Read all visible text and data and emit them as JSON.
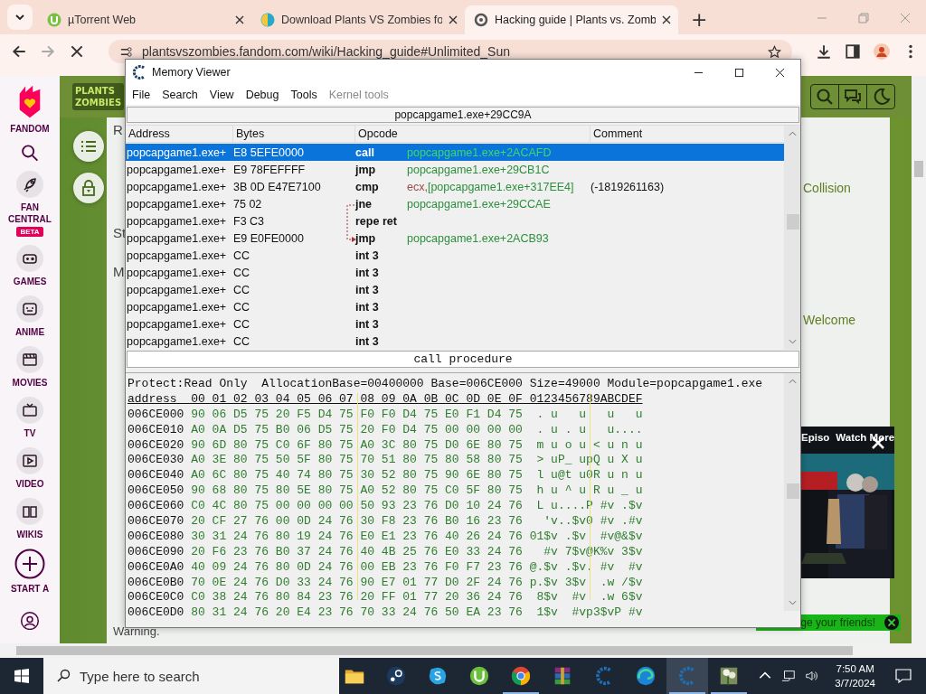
{
  "browser": {
    "tabs": [
      {
        "title": "µTorrent Web",
        "kind": "utorrent",
        "selected": false
      },
      {
        "title": "Download Plants VS Zombies fo",
        "kind": "globe",
        "selected": false
      },
      {
        "title": "Hacking guide | Plants vs. Zomb",
        "kind": "fandom",
        "selected": true
      }
    ],
    "new_tab": "+",
    "url": "plantsvszombies.fandom.com/wiki/Hacking_guide#Unlimited_Sun"
  },
  "fandom_nav": {
    "brand": "FANDOM",
    "items": [
      {
        "label": "FAN CENTRAL",
        "badge": "BETA",
        "kind": "rocket"
      },
      {
        "label": "GAMES",
        "kind": "games"
      },
      {
        "label": "ANIME",
        "kind": "anime"
      },
      {
        "label": "MOVIES",
        "kind": "movies"
      },
      {
        "label": "TV",
        "kind": "tv"
      },
      {
        "label": "VIDEO",
        "kind": "video"
      },
      {
        "label": "WIKIS",
        "kind": "wikis"
      },
      {
        "label": "START A",
        "kind": "plus"
      }
    ]
  },
  "site": {
    "logo": [
      "PLANTS",
      "ZOMBIES"
    ]
  },
  "article": {
    "left_texts": [
      "R",
      "St",
      "M"
    ],
    "right_texts": [
      "Collision",
      "Welcome"
    ],
    "warning": "Warning."
  },
  "video_ad": {
    "title": "Episo",
    "action": "Watch More"
  },
  "banner": {
    "text": "ge your friends!"
  },
  "memory_viewer": {
    "title": "Memory Viewer",
    "menu": [
      {
        "label": "File",
        "disabled": false
      },
      {
        "label": "Search",
        "disabled": false
      },
      {
        "label": "View",
        "disabled": false
      },
      {
        "label": "Debug",
        "disabled": false
      },
      {
        "label": "Tools",
        "disabled": false
      },
      {
        "label": "Kernel tools",
        "disabled": true
      }
    ],
    "location": "popcapgame1.exe+29CC9A",
    "columns": [
      "Address",
      "Bytes",
      "Opcode",
      "Comment"
    ],
    "rows": [
      {
        "address": "popcapgame1.exe+",
        "bytes": "E8 5EFE0000",
        "opcode": "call",
        "operand": [
          {
            "text": "popcapgame1.exe+2ACAFD",
            "kind": "address"
          }
        ],
        "selected": true
      },
      {
        "address": "popcapgame1.exe+",
        "bytes": "E9 78FEFFFF",
        "opcode": "jmp",
        "operand": [
          {
            "text": "popcapgame1.exe+29CB1C",
            "kind": "address"
          }
        ],
        "selected": false
      },
      {
        "address": "popcapgame1.exe+",
        "bytes": "3B 0D E47E7100",
        "opcode": "cmp",
        "operand": [
          {
            "text": "ecx,",
            "kind": "register"
          },
          {
            "text": "[popcapgame1.exe+317EE4]",
            "kind": "address"
          }
        ],
        "comment": "(-1819261163)",
        "selected": false
      },
      {
        "address": "popcapgame1.exe+",
        "bytes": "75 02",
        "opcode": "jne",
        "operand": [
          {
            "text": "popcapgame1.exe+29CCAE",
            "kind": "address"
          }
        ],
        "selected": false
      },
      {
        "address": "popcapgame1.exe+",
        "bytes": "F3 C3",
        "opcode": "repe ret",
        "selected": false
      },
      {
        "address": "popcapgame1.exe+",
        "bytes": "E9 E0FE0000",
        "opcode": "jmp",
        "operand": [
          {
            "text": "popcapgame1.exe+2ACB93",
            "kind": "address"
          }
        ],
        "selected": false
      },
      {
        "address": "popcapgame1.exe+",
        "bytes": "CC",
        "opcode": "int 3",
        "selected": false
      },
      {
        "address": "popcapgame1.exe+",
        "bytes": "CC",
        "opcode": "int 3",
        "selected": false
      },
      {
        "address": "popcapgame1.exe+",
        "bytes": "CC",
        "opcode": "int 3",
        "selected": false
      },
      {
        "address": "popcapgame1.exe+",
        "bytes": "CC",
        "opcode": "int 3",
        "selected": false
      },
      {
        "address": "popcapgame1.exe+",
        "bytes": "CC",
        "opcode": "int 3",
        "selected": false
      },
      {
        "address": "popcapgame1.exe+",
        "bytes": "CC",
        "opcode": "int 3",
        "selected": false
      }
    ],
    "status": "call procedure",
    "hex": {
      "info": "Protect:Read Only  AllocationBase=00400000 Base=006CE000 Size=49000 Module=popcapgame1.exe",
      "header": "address  00 01 02 03 04 05 06 07 08 09 0A 0B 0C 0D 0E 0F 0123456789ABCDEF",
      "rows": [
        {
          "address": "006CE000",
          "bytes": "90 06 D5 75 20 F5 D4 75 F0 F0 D4 75 E0 F1 D4 75",
          "ascii": " . u   u   u   u"
        },
        {
          "address": "006CE010",
          "bytes": "A0 0A D5 75 B0 06 D5 75 20 F0 D4 75 00 00 00 00",
          "ascii": " . u . u   u...."
        },
        {
          "address": "006CE020",
          "bytes": "90 6D 80 75 C0 6F 80 75 A0 3C 80 75 D0 6E 80 75",
          "ascii": " m u o u < u n u"
        },
        {
          "address": "006CE030",
          "bytes": "A0 3E 80 75 50 5F 80 75 70 51 80 75 80 58 80 75",
          "ascii": " > uP_ upQ u X u"
        },
        {
          "address": "006CE040",
          "bytes": "A0 6C 80 75 40 74 80 75 30 52 80 75 90 6E 80 75",
          "ascii": " l u@t u0R u n u"
        },
        {
          "address": "006CE050",
          "bytes": "90 68 80 75 80 5E 80 75 A0 52 80 75 C0 5F 80 75",
          "ascii": " h u ^ u R u _ u"
        },
        {
          "address": "006CE060",
          "bytes": "C0 4C 80 75 00 00 00 00 50 93 23 76 D0 10 24 76",
          "ascii": " L u....P #v .$v"
        },
        {
          "address": "006CE070",
          "bytes": "20 CF 27 76 00 0D 24 76 30 F8 23 76 B0 16 23 76",
          "ascii": "  'v..$v0 #v .#v"
        },
        {
          "address": "006CE080",
          "bytes": "30 31 24 76 80 19 24 76 E0 E1 23 76 40 26 24 76",
          "ascii": "01$v .$v  #v@&$v"
        },
        {
          "address": "006CE090",
          "bytes": "20 F6 23 76 B0 37 24 76 40 4B 25 76 E0 33 24 76",
          "ascii": "  #v 7$v@K%v 3$v"
        },
        {
          "address": "006CE0A0",
          "bytes": "40 09 24 76 80 0D 24 76 00 EB 23 76 F0 F7 23 76",
          "ascii": "@.$v .$v. #v  #v"
        },
        {
          "address": "006CE0B0",
          "bytes": "70 0E 24 76 D0 33 24 76 90 E7 01 77 D0 2F 24 76",
          "ascii": "p.$v 3$v  .w /$v"
        },
        {
          "address": "006CE0C0",
          "bytes": "C0 38 24 76 80 84 23 76 20 FF 01 77 20 36 24 76",
          "ascii": " 8$v  #v  .w 6$v"
        },
        {
          "address": "006CE0D0",
          "bytes": "80 31 24 76 20 E4 23 76 70 33 24 76 50 EA 23 76",
          "ascii": " 1$v  #vp3$vP #v"
        }
      ]
    }
  },
  "taskbar": {
    "search_placeholder": "Type here to search",
    "apps": [
      {
        "kind": "folder",
        "running": false,
        "selected": false
      },
      {
        "kind": "steam",
        "running": false,
        "selected": false
      },
      {
        "kind": "skype",
        "running": false,
        "selected": false
      },
      {
        "kind": "utorrent",
        "running": false,
        "selected": false
      },
      {
        "kind": "chrome",
        "running": true,
        "selected": false
      },
      {
        "kind": "archive",
        "running": false,
        "selected": false
      },
      {
        "kind": "cheat-engine",
        "running": false,
        "selected": false
      },
      {
        "kind": "edge",
        "running": false,
        "selected": false
      },
      {
        "kind": "cheat-engine",
        "running": true,
        "selected": true
      },
      {
        "kind": "plant",
        "running": true,
        "selected": false
      }
    ],
    "time": "7:50 AM",
    "date": "3/7/2024"
  }
}
